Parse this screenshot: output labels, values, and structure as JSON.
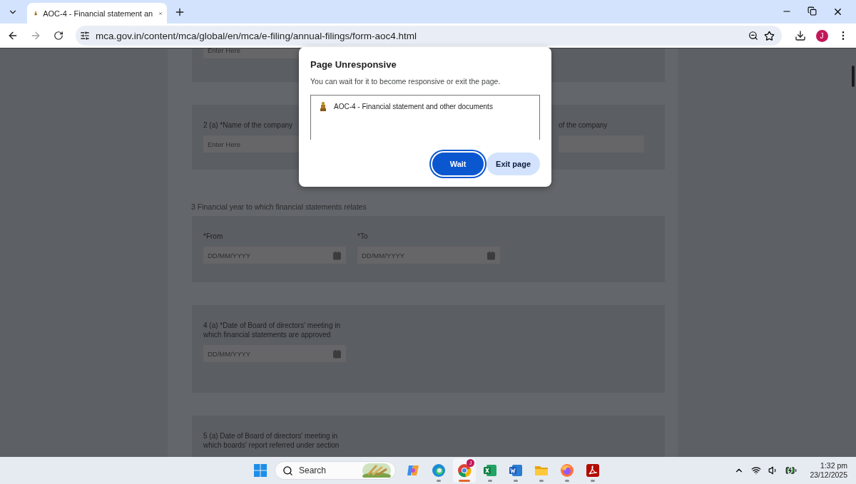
{
  "browser": {
    "tabs": [
      {
        "title": "AOC-4 - Financial statement an",
        "selected": true
      }
    ],
    "forward_disabled": true,
    "url": "mca.gov.in/content/mca/global/en/mca/e-filing/annual-filings/form-aoc4.html",
    "profile_initial": "J"
  },
  "form": {
    "blocks": [
      {
        "kind": "card",
        "fields": [
          {
            "kind": "text",
            "placeholder": "Enter Here"
          }
        ]
      },
      {
        "kind": "card",
        "fields": [
          {
            "kind": "text",
            "label": "2 (a) *Name of the company",
            "placeholder": "Enter Here"
          },
          {
            "kind": "text",
            "label": "of the company"
          }
        ]
      },
      {
        "kind": "heading",
        "text": "3 Financial year to which financial statements relates"
      },
      {
        "kind": "card",
        "fields": [
          {
            "kind": "date",
            "label": "*From",
            "placeholder": "DD/MM/YYYY"
          },
          {
            "kind": "date",
            "label": "*To",
            "placeholder": "DD/MM/YYYY"
          }
        ]
      },
      {
        "kind": "card",
        "fields": [
          {
            "kind": "date",
            "label": "4 (a) *Date of Board of directors' meeting in which financial statements are approved",
            "placeholder": "DD/MM/YYYY"
          }
        ]
      },
      {
        "kind": "card",
        "fields": [
          {
            "kind": "label",
            "label": "5 (a) Date of Board of directors' meeting in which boards' report referred under section"
          }
        ]
      }
    ]
  },
  "dialog": {
    "title": "Page Unresponsive",
    "message": "You can wait for it to become responsive or exit the page.",
    "pages": [
      "AOC-4 - Financial statement and other documents"
    ],
    "buttons": [
      {
        "kind": "primary",
        "label": "Wait"
      },
      {
        "kind": "secondary",
        "label": "Exit page"
      }
    ]
  },
  "taskbar": {
    "search_placeholder": "Search",
    "apps": [
      {
        "kind": "copilot",
        "running": false,
        "selected": false
      },
      {
        "kind": "edge",
        "running": true,
        "selected": false
      },
      {
        "kind": "chrome",
        "running": true,
        "selected": true,
        "badge": "J"
      },
      {
        "kind": "excel",
        "running": true,
        "selected": false
      },
      {
        "kind": "word",
        "running": true,
        "selected": false
      },
      {
        "kind": "explorer",
        "running": true,
        "selected": false
      },
      {
        "kind": "firefox",
        "running": true,
        "selected": false
      },
      {
        "kind": "acrobat",
        "running": true,
        "selected": false
      }
    ],
    "time": "1:32 pm",
    "date": "23/12/2025"
  }
}
